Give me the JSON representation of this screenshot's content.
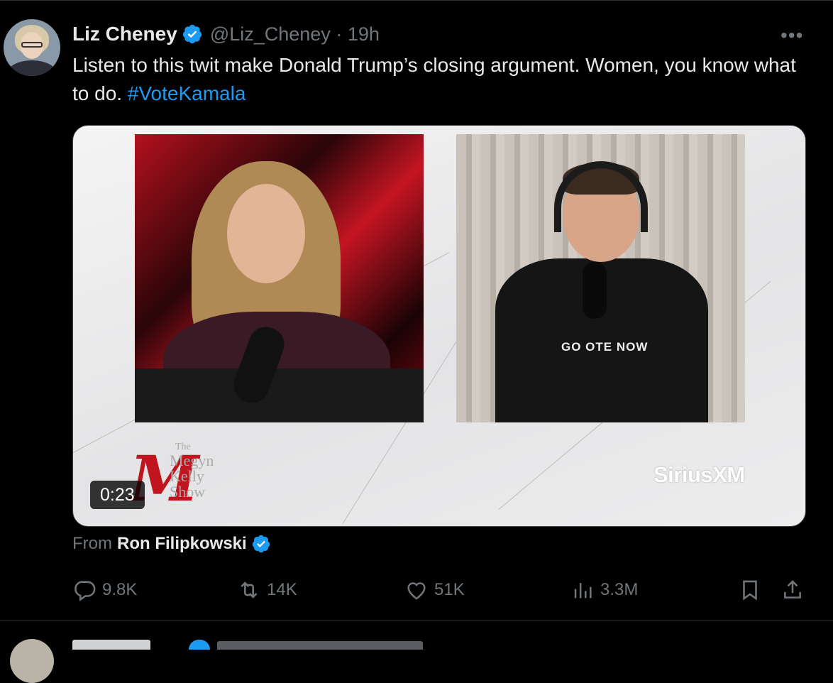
{
  "tweet": {
    "author_name": "Liz Cheney",
    "handle": "@Liz_Cheney",
    "time": "· 19h",
    "text_main": "Listen to this twit make Donald Trump’s closing argument. Women, you know what to do. ",
    "hashtag": "#VoteKamala",
    "more_icon": "more-dots-icon",
    "verified_icon": "verified-badge-icon"
  },
  "media": {
    "duration": "0:23",
    "left_show_title_line1": "The",
    "left_show_title_line2": "Megyn",
    "left_show_title_line3": "Kelly",
    "left_show_title_line4": "Show",
    "left_logo_letter": "M",
    "shirt_text": "GO  OTE NOW",
    "network_logo": "SiriusXM"
  },
  "attribution": {
    "prefix": "From",
    "source_name": "Ron Filipkowski"
  },
  "actions": {
    "replies": "9.8K",
    "reposts": "14K",
    "likes": "51K",
    "views": "3.3M"
  },
  "colors": {
    "background": "#000000",
    "text": "#e7e9ea",
    "muted": "#71767b",
    "accent": "#1d9bf0"
  }
}
